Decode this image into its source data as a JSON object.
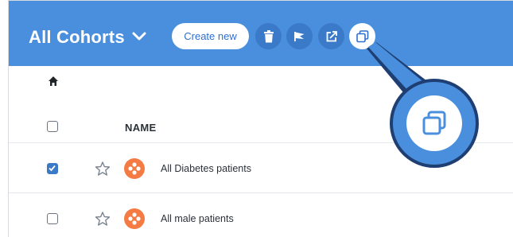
{
  "header": {
    "title": "All Cohorts",
    "create_label": "Create new",
    "actions": [
      "trash-icon",
      "flag-icon",
      "share-icon",
      "duplicate-icon"
    ],
    "colors": {
      "bar": "#4a8fdd",
      "accent": "#2f6fcf",
      "callout_border": "#1f3f73",
      "avatar": "#f47b44"
    }
  },
  "table": {
    "column_name": "NAME",
    "rows": [
      {
        "name": "All Diabetes patients",
        "checked": true
      },
      {
        "name": "All male patients",
        "checked": false
      }
    ]
  }
}
